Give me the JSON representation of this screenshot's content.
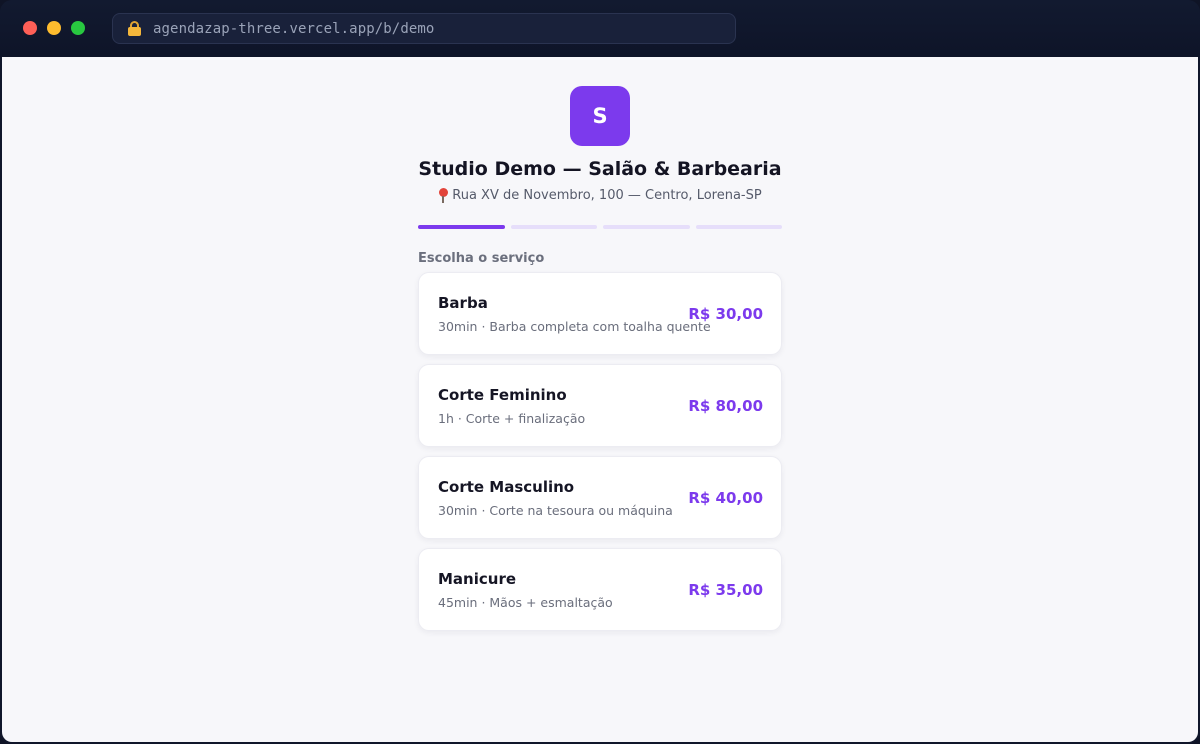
{
  "browser": {
    "url": "agendazap-three.vercel.app/b/demo"
  },
  "business": {
    "logo_letter": "S",
    "name": "Studio Demo — Salão & Barbearia",
    "address": "Rua XV de Novembro, 100 — Centro, Lorena-SP"
  },
  "progress": {
    "current_step": 1,
    "total_steps": 4
  },
  "section_label": "Escolha o serviço",
  "services": [
    {
      "name": "Barba",
      "desc": "30min · Barba completa com toalha quente",
      "price": "R$ 30,00"
    },
    {
      "name": "Corte Feminino",
      "desc": "1h · Corte + finalização",
      "price": "R$ 80,00"
    },
    {
      "name": "Corte Masculino",
      "desc": "30min · Corte na tesoura ou máquina",
      "price": "R$ 40,00"
    },
    {
      "name": "Manicure",
      "desc": "45min · Mãos + esmaltação",
      "price": "R$ 35,00"
    }
  ],
  "colors": {
    "accent": "#7c3aed",
    "accent_light": "#e6defa"
  }
}
